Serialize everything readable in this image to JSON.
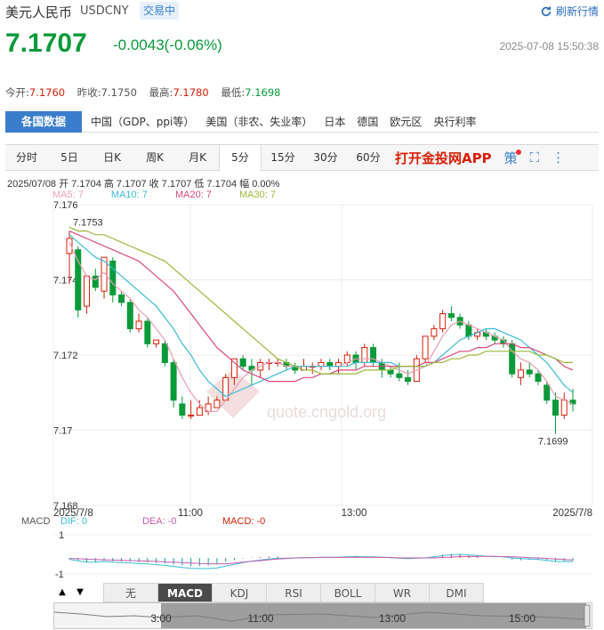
{
  "header": {
    "name": "美元人民币",
    "code": "USDCNY",
    "status": "交易中",
    "refresh_label": "刷新行情"
  },
  "quote": {
    "price": "7.1707",
    "change": "-0.0043(-0.06%)",
    "timestamp": "2025-07-08 15:50:38"
  },
  "stats": [
    {
      "label": "今开:",
      "value": "7.1760",
      "color": "red"
    },
    {
      "label": "昨收:",
      "value": "7.1750",
      "color": "none"
    },
    {
      "label": "最高:",
      "value": "7.1780",
      "color": "red"
    },
    {
      "label": "最低:",
      "value": "7.1698",
      "color": "grn"
    }
  ],
  "data_nav": {
    "title": "各国数据",
    "links": [
      "中国（GDP、ppi等）",
      "美国（非农、失业率）",
      "日本",
      "德国",
      "欧元区",
      "央行利率"
    ]
  },
  "period_tabs": [
    "分时",
    "5日",
    "日K",
    "周K",
    "月K",
    "5分",
    "15分",
    "30分",
    "60分"
  ],
  "active_period": "5分",
  "app_link": "打开金投网APP",
  "toolbar_icons": [
    "策",
    "⛶",
    "⋮"
  ],
  "ohlc_line": "2025/07/08  开 7.1704  高 7.1707  收 7.1707  低 7.1704  幅 0.00%",
  "ma_legend": [
    {
      "label": "MA5: 7",
      "color": "#e8a0b0"
    },
    {
      "label": "MA10: 7",
      "color": "#3bbcd6"
    },
    {
      "label": "MA20: 7",
      "color": "#d84a7a"
    },
    {
      "label": "MA30: 7",
      "color": "#9ab83a"
    }
  ],
  "macd_legend": {
    "name": "MACD",
    "dif": "DIF: 0",
    "dea": "DEA: -0",
    "macd": "MACD: -0"
  },
  "indicator_tabs": [
    "无",
    "MACD",
    "KDJ",
    "RSI",
    "BOLL",
    "WR",
    "DMI"
  ],
  "active_indicator": "MACD",
  "chart_data": {
    "type": "candlestick",
    "y_ticks": [
      "7.176",
      "7.174",
      "7.172",
      "7.17",
      "7.168"
    ],
    "ylim": [
      7.168,
      7.176
    ],
    "x_ticks": [
      "2025/7/8",
      "11:00",
      "13:00",
      "2025/7/8"
    ],
    "high_label": "7.1753",
    "low_label": "7.1699",
    "watermark": "quote.cngold.org",
    "candles": [
      [
        7.1747,
        7.1753,
        7.1739,
        7.1751
      ],
      [
        7.1748,
        7.1749,
        7.173,
        7.1732
      ],
      [
        7.1733,
        7.1741,
        7.1731,
        7.1741
      ],
      [
        7.1741,
        7.1743,
        7.1737,
        7.1738
      ],
      [
        7.1737,
        7.1746,
        7.1735,
        7.1746
      ],
      [
        7.1745,
        7.1746,
        7.1734,
        7.1736
      ],
      [
        7.1736,
        7.1737,
        7.1733,
        7.1734
      ],
      [
        7.1734,
        7.1735,
        7.1726,
        7.1727
      ],
      [
        7.1727,
        7.1731,
        7.1726,
        7.1729
      ],
      [
        7.1729,
        7.173,
        7.1722,
        7.1723
      ],
      [
        7.1723,
        7.1724,
        7.1722,
        7.1724
      ],
      [
        7.1723,
        7.1724,
        7.1717,
        7.1718
      ],
      [
        7.1718,
        7.1719,
        7.1706,
        7.1708
      ],
      [
        7.1707,
        7.1709,
        7.1703,
        7.1704
      ],
      [
        7.1704,
        7.1708,
        7.1703,
        7.1704
      ],
      [
        7.1704,
        7.1708,
        7.1704,
        7.1706
      ],
      [
        7.1705,
        7.1709,
        7.1704,
        7.1707
      ],
      [
        7.1706,
        7.1709,
        7.1706,
        7.1708
      ],
      [
        7.1708,
        7.1715,
        7.1708,
        7.1714
      ],
      [
        7.1714,
        7.1719,
        7.1712,
        7.1719
      ],
      [
        7.1719,
        7.172,
        7.1716,
        7.1717
      ],
      [
        7.1717,
        7.1719,
        7.1712,
        7.1716
      ],
      [
        7.1716,
        7.1719,
        7.1714,
        7.1718
      ],
      [
        7.1718,
        7.1719,
        7.1716,
        7.1718
      ],
      [
        7.1718,
        7.1719,
        7.1717,
        7.1718
      ],
      [
        7.1718,
        7.1719,
        7.1716,
        7.1717
      ],
      [
        7.1717,
        7.1718,
        7.1715,
        7.1716
      ],
      [
        7.1716,
        7.1719,
        7.1716,
        7.1717
      ],
      [
        7.1717,
        7.1718,
        7.1715,
        7.1717
      ],
      [
        7.1717,
        7.1719,
        7.1716,
        7.1718
      ],
      [
        7.1718,
        7.1719,
        7.1716,
        7.1717
      ],
      [
        7.1717,
        7.1719,
        7.1715,
        7.1718
      ],
      [
        7.1718,
        7.1721,
        7.1717,
        7.172
      ],
      [
        7.172,
        7.1721,
        7.1716,
        7.1718
      ],
      [
        7.1718,
        7.1723,
        7.1717,
        7.1722
      ],
      [
        7.1722,
        7.1723,
        7.1717,
        7.1718
      ],
      [
        7.1718,
        7.1719,
        7.1714,
        7.1716
      ],
      [
        7.1716,
        7.1717,
        7.1714,
        7.1715
      ],
      [
        7.1715,
        7.1718,
        7.1713,
        7.1714
      ],
      [
        7.1714,
        7.1716,
        7.1712,
        7.1713
      ],
      [
        7.1713,
        7.172,
        7.1713,
        7.1719
      ],
      [
        7.1719,
        7.1725,
        7.1718,
        7.1725
      ],
      [
        7.1725,
        7.1728,
        7.1724,
        7.1727
      ],
      [
        7.1727,
        7.1732,
        7.1726,
        7.1731
      ],
      [
        7.1731,
        7.1733,
        7.1729,
        7.173
      ],
      [
        7.173,
        7.1731,
        7.1727,
        7.1728
      ],
      [
        7.1728,
        7.1729,
        7.1724,
        7.1725
      ],
      [
        7.1725,
        7.1727,
        7.1724,
        7.1726
      ],
      [
        7.1726,
        7.1727,
        7.1724,
        7.1725
      ],
      [
        7.1725,
        7.1726,
        7.1723,
        7.1724
      ],
      [
        7.1724,
        7.1725,
        7.1722,
        7.1723
      ],
      [
        7.1723,
        7.1724,
        7.1714,
        7.1715
      ],
      [
        7.1714,
        7.1718,
        7.1712,
        7.1716
      ],
      [
        7.1716,
        7.1718,
        7.1714,
        7.1715
      ],
      [
        7.1715,
        7.1716,
        7.1712,
        7.1713
      ],
      [
        7.1712,
        7.1713,
        7.1707,
        7.1708
      ],
      [
        7.1708,
        7.171,
        7.1699,
        7.1704
      ],
      [
        7.1704,
        7.171,
        7.1703,
        7.1708
      ],
      [
        7.1708,
        7.1711,
        7.1705,
        7.1707
      ]
    ],
    "ma": {
      "MA5": [
        7.175,
        7.1745,
        7.1741,
        7.174,
        7.1742,
        7.1739,
        7.1737,
        7.1735,
        7.1732,
        7.173,
        7.1727,
        7.1724,
        7.1719,
        7.1714,
        7.171,
        7.1707,
        7.1705,
        7.1705,
        7.1708,
        7.1711,
        7.1714,
        7.1716,
        7.1717,
        7.1718,
        7.1718,
        7.1717,
        7.1717,
        7.1717,
        7.1717,
        7.1717,
        7.1717,
        7.1717,
        7.1718,
        7.1719,
        7.1719,
        7.1719,
        7.1718,
        7.1717,
        7.1716,
        7.1715,
        7.1716,
        7.1717,
        7.1721,
        7.1725,
        7.1728,
        7.1729,
        7.1728,
        7.1727,
        7.1726,
        7.1725,
        7.1724,
        7.1721,
        7.1719,
        7.1718,
        7.1716,
        7.1713,
        7.1709,
        7.1708,
        7.1707
      ],
      "MA10": [
        7.1752,
        7.175,
        7.1748,
        7.1746,
        7.1745,
        7.1743,
        7.1741,
        7.1739,
        7.1737,
        7.1735,
        7.1733,
        7.173,
        7.1727,
        7.1723,
        7.172,
        7.1716,
        7.1713,
        7.1711,
        7.1709,
        7.171,
        7.1711,
        7.1712,
        7.1713,
        7.1714,
        7.1715,
        7.1716,
        7.1717,
        7.1717,
        7.1717,
        7.1717,
        7.1717,
        7.1717,
        7.1717,
        7.1718,
        7.1718,
        7.1718,
        7.1718,
        7.1718,
        7.1717,
        7.1717,
        7.1717,
        7.1717,
        7.1718,
        7.172,
        7.1722,
        7.1724,
        7.1725,
        7.1726,
        7.1727,
        7.1727,
        7.1726,
        7.1725,
        7.1724,
        7.1722,
        7.172,
        7.1718,
        7.1715,
        7.1712,
        7.171
      ],
      "MA20": [
        7.1753,
        7.1752,
        7.1751,
        7.175,
        7.1749,
        7.1748,
        7.1747,
        7.1746,
        7.1745,
        7.1743,
        7.1741,
        7.1739,
        7.1737,
        7.1734,
        7.1731,
        7.1728,
        7.1725,
        7.1722,
        7.172,
        7.1718,
        7.1716,
        7.1715,
        7.1714,
        7.1713,
        7.1713,
        7.1713,
        7.1713,
        7.1714,
        7.1714,
        7.1715,
        7.1715,
        7.1716,
        7.1716,
        7.1716,
        7.1717,
        7.1717,
        7.1717,
        7.1717,
        7.1717,
        7.1717,
        7.1717,
        7.1718,
        7.1718,
        7.1719,
        7.172,
        7.1721,
        7.1721,
        7.1722,
        7.1722,
        7.1723,
        7.1723,
        7.1723,
        7.1722,
        7.1722,
        7.1721,
        7.172,
        7.1719,
        7.1717,
        7.1716
      ],
      "MA30": [
        7.1754,
        7.1753,
        7.1753,
        7.1752,
        7.1752,
        7.1751,
        7.175,
        7.1749,
        7.1748,
        7.1747,
        7.1746,
        7.1745,
        7.1743,
        7.1741,
        7.1739,
        7.1737,
        7.1735,
        7.1733,
        7.1731,
        7.1729,
        7.1727,
        7.1725,
        7.1723,
        7.1721,
        7.1719,
        7.1718,
        7.1717,
        7.1716,
        7.1716,
        7.1715,
        7.1715,
        7.1715,
        7.1715,
        7.1715,
        7.1716,
        7.1716,
        7.1716,
        7.1716,
        7.1717,
        7.1717,
        7.1717,
        7.1717,
        7.1718,
        7.1718,
        7.1719,
        7.1719,
        7.172,
        7.172,
        7.1721,
        7.1721,
        7.1721,
        7.1721,
        7.1721,
        7.1721,
        7.172,
        7.172,
        7.1719,
        7.1718,
        7.1718
      ]
    },
    "macd_ticks": [
      "1",
      "-1"
    ],
    "nav_labels": [
      "3:00",
      "11:00",
      "13:00",
      "15:00"
    ]
  }
}
